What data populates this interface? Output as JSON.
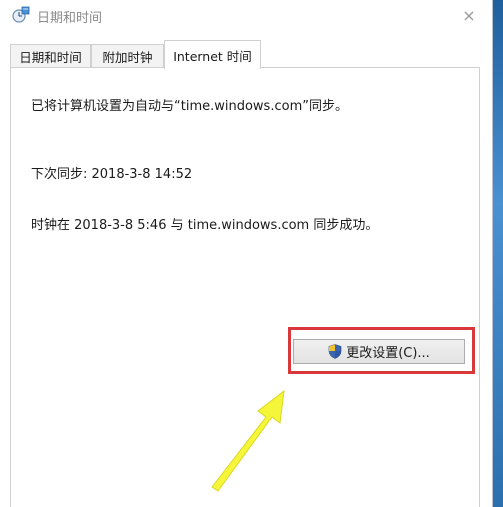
{
  "window": {
    "title": "日期和时间",
    "close_glyph": "×"
  },
  "tabs": [
    {
      "label": "日期和时间",
      "active": false
    },
    {
      "label": "附加时钟",
      "active": false
    },
    {
      "label": "Internet 时间",
      "active": true
    }
  ],
  "internet_time": {
    "auto_sync_text": "已将计算机设置为自动与“time.windows.com”同步。",
    "next_sync_text": "下次同步: 2018-3-8 14:52",
    "last_sync_text": "时钟在 2018-3-8 5:46 与 time.windows.com 同步成功。",
    "change_settings_label": "更改设置(C)..."
  },
  "icons": {
    "title": "clock-globe-icon",
    "button": "uac-shield-icon",
    "annotation": "yellow-arrow-icon"
  },
  "colors": {
    "highlight": "#d9383a",
    "arrow": "#f5f53a",
    "desktop": "#2b6fb3"
  }
}
